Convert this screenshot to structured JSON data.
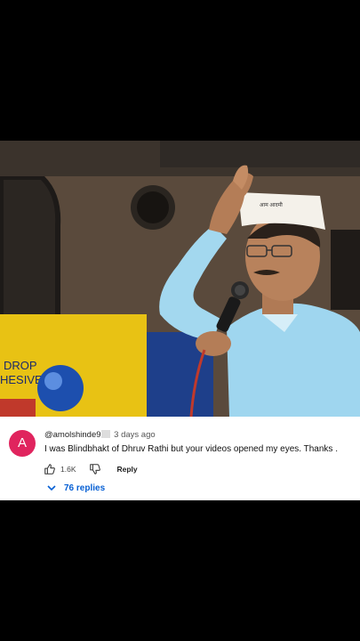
{
  "comment": {
    "avatar_letter": "A",
    "avatar_color": "#e0245e",
    "handle": "@amolshinde9",
    "time": "3 days ago",
    "text": "I was Blindbhakt of Dhruv Rathi but your videos opened my eyes. Thanks .",
    "like_count": "1.6K",
    "reply_label": "Reply",
    "replies_label": "76 replies"
  },
  "video": {
    "banner_text_line1": "DROP",
    "banner_text_line2": "HESIVE"
  },
  "colors": {
    "replies_link": "#065fd4",
    "card_background": "#ffffff"
  },
  "icons": {
    "like": "thumbs-up-icon",
    "dislike": "thumbs-down-icon",
    "expand": "chevron-down-icon"
  }
}
